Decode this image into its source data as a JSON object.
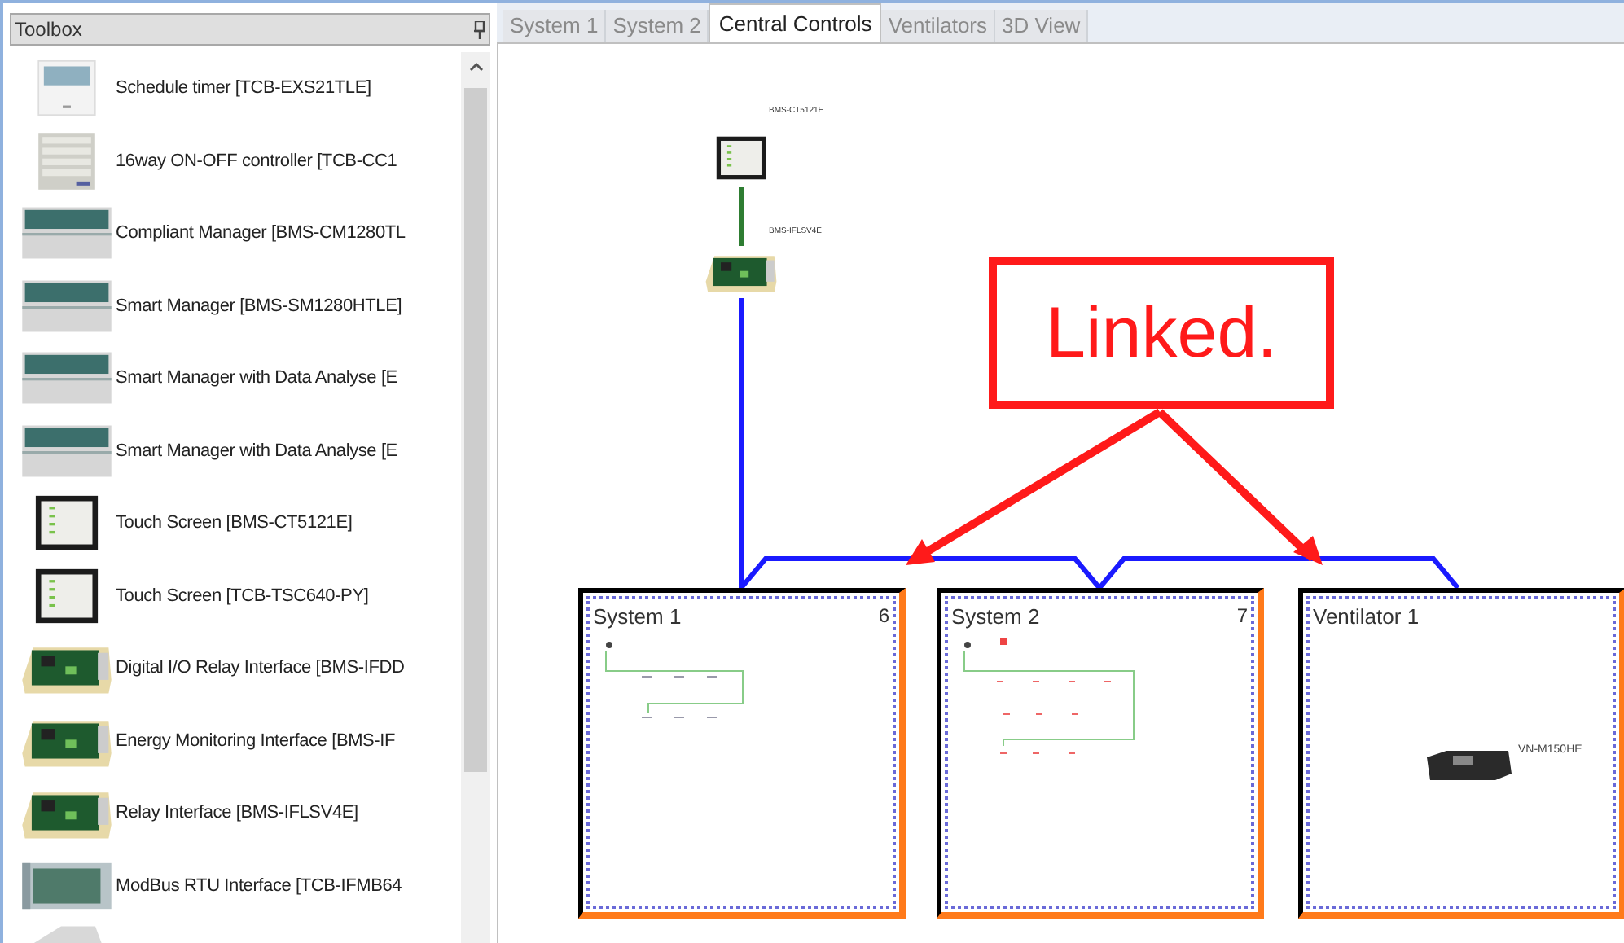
{
  "toolbox": {
    "title": "Toolbox",
    "items": [
      {
        "kind": "timer",
        "label": "Schedule timer [TCB-EXS21TLE]"
      },
      {
        "kind": "controller",
        "label": "16way ON-OFF controller [TCB-CC1"
      },
      {
        "kind": "manager",
        "label": "Compliant Manager [BMS-CM1280TL"
      },
      {
        "kind": "manager",
        "label": "Smart Manager [BMS-SM1280HTLE]"
      },
      {
        "kind": "manager",
        "label": "Smart Manager with Data Analyse [E"
      },
      {
        "kind": "manager",
        "label": "Smart Manager with Data Analyse [E"
      },
      {
        "kind": "touchscreen",
        "label": "Touch Screen [BMS-CT5121E]"
      },
      {
        "kind": "touchscreen",
        "label": "Touch Screen [TCB-TSC640-PY]"
      },
      {
        "kind": "board",
        "label": "Digital I/O Relay Interface [BMS-IFDD"
      },
      {
        "kind": "board",
        "label": "Energy Monitoring Interface [BMS-IF"
      },
      {
        "kind": "board",
        "label": "Relay Interface [BMS-IFLSV4E]"
      },
      {
        "kind": "modbus",
        "label": "ModBus RTU Interface [TCB-IFMB64"
      },
      {
        "kind": "panel"
      }
    ]
  },
  "tabs": [
    {
      "label": "System 1",
      "selected": false
    },
    {
      "label": "System 2",
      "selected": false
    },
    {
      "label": "Central Controls",
      "selected": true
    },
    {
      "label": "Ventilators",
      "selected": false
    },
    {
      "label": "3D View",
      "selected": false
    }
  ],
  "canvas": {
    "devices": [
      {
        "kind": "touchscreen",
        "label": "BMS-CT5121E"
      },
      {
        "kind": "board",
        "label": "BMS-IFLSV4E"
      }
    ],
    "callout": "Linked.",
    "groups": [
      {
        "kind": "system",
        "title": "System 1",
        "count": "6"
      },
      {
        "kind": "system",
        "title": "System 2",
        "count": "7"
      },
      {
        "kind": "ventilator",
        "title": "Ventilator 1",
        "device_label": "VN-M150HE"
      }
    ]
  }
}
